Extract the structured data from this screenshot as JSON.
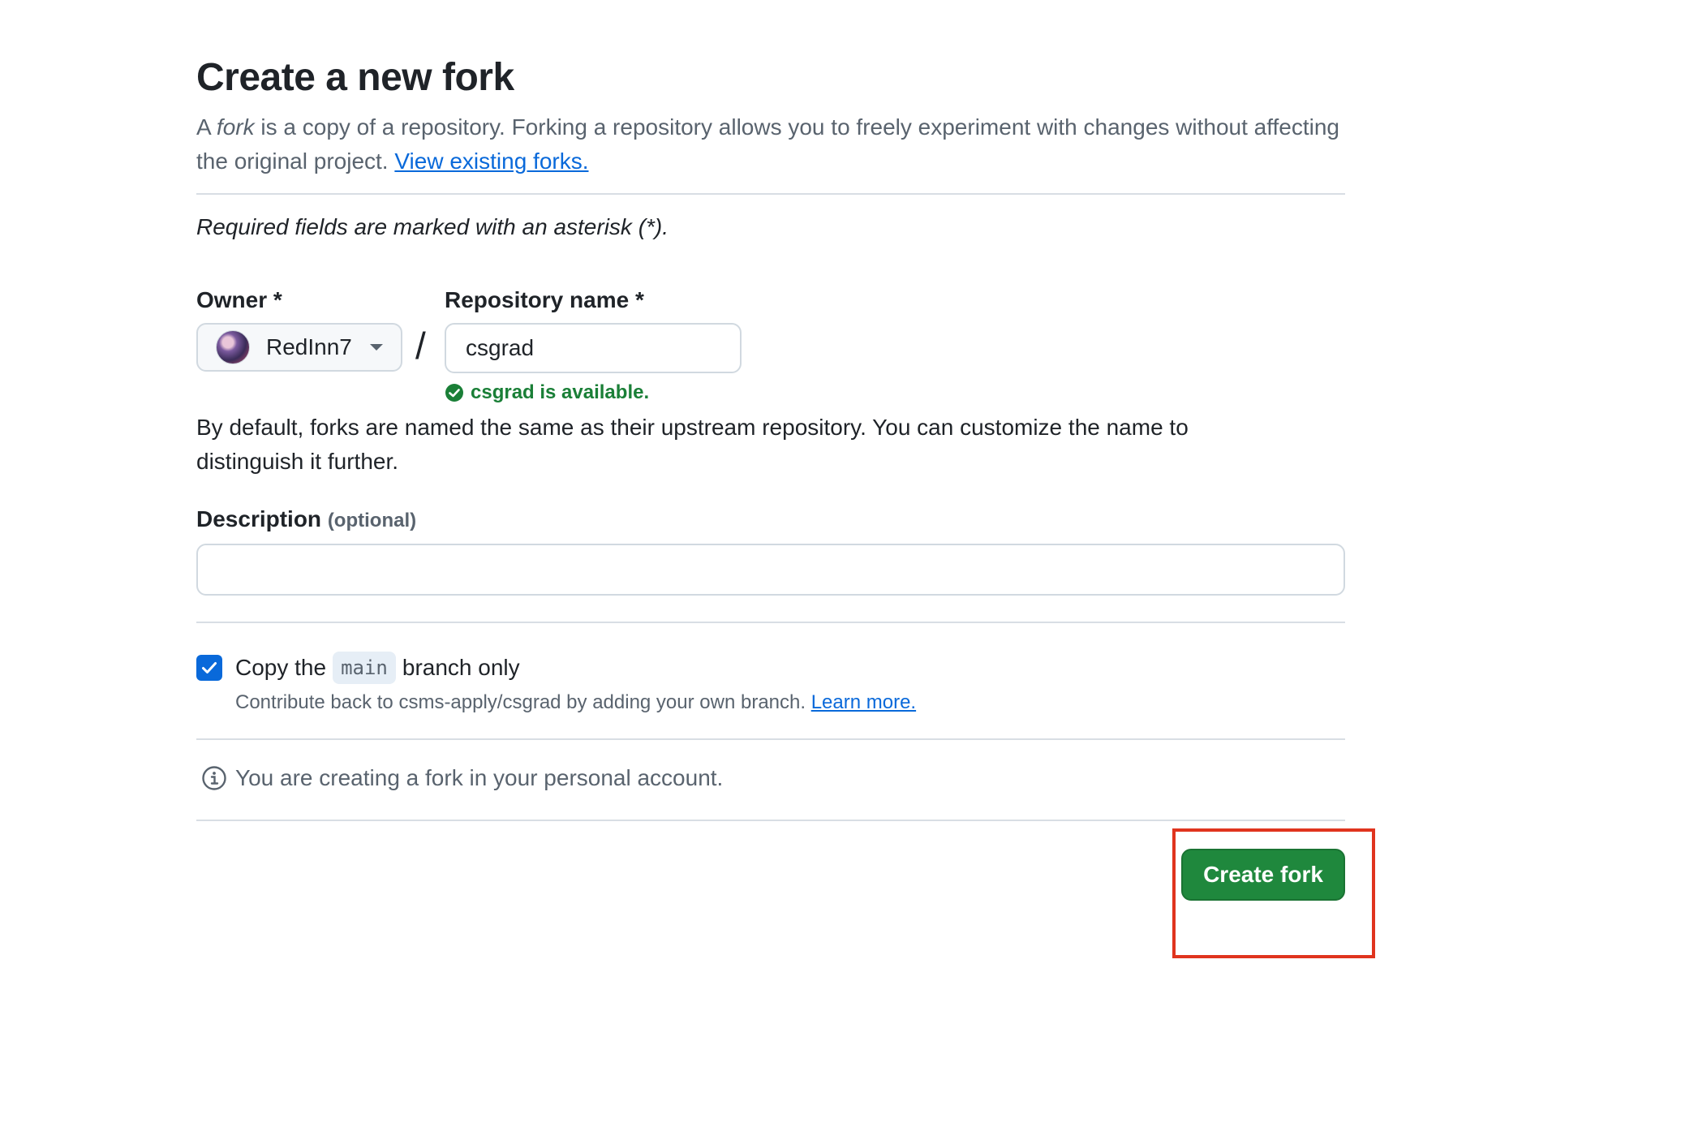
{
  "header": {
    "title": "Create a new fork",
    "subtitle_prefix": "A ",
    "subtitle_em": "fork",
    "subtitle_rest": " is a copy of a repository. Forking a repository allows you to freely experiment with changes without affecting the original project. ",
    "view_forks_link": "View existing forks."
  },
  "required_note": "Required fields are marked with an asterisk (*).",
  "owner": {
    "label": "Owner *",
    "selected": "RedInn7"
  },
  "separator": "/",
  "repository": {
    "label": "Repository name *",
    "value": "csgrad",
    "availability": "csgrad is available."
  },
  "help_text": "By default, forks are named the same as their upstream repository. You can customize the name to distinguish it further.",
  "description": {
    "label": "Description",
    "optional": "(optional)",
    "value": ""
  },
  "copy_branch": {
    "checked": true,
    "label_before": "Copy the",
    "branch": "main",
    "label_after": "branch only",
    "sub_text": "Contribute back to csms-apply/csgrad by adding your own branch. ",
    "learn_more": "Learn more."
  },
  "info": {
    "icon": "info-icon",
    "text": "You are creating a fork in your personal account."
  },
  "actions": {
    "create_fork_label": "Create fork"
  },
  "colors": {
    "primary_button": "#1f883d",
    "link": "#0969da",
    "success": "#1a7f37",
    "highlight": "#e0341e"
  }
}
